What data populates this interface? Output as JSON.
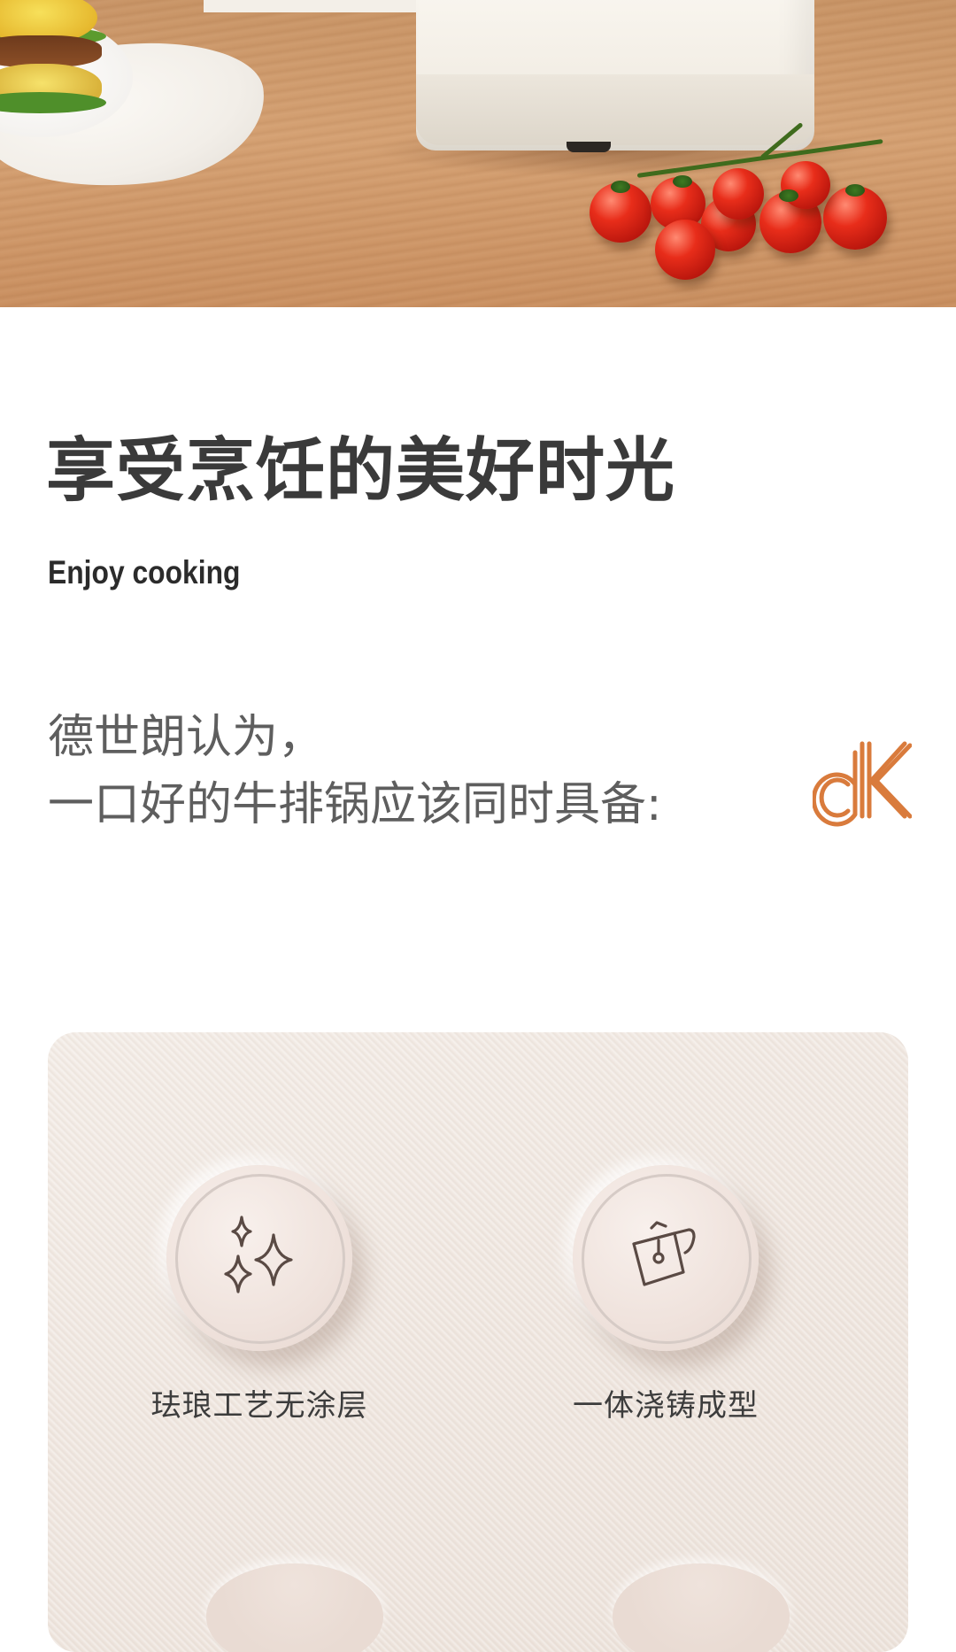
{
  "brand": {
    "accent": "#d97b3c",
    "text_dark": "#3a3a3a",
    "text_grey": "#5e5e5e"
  },
  "hero": {
    "image_subject": "kitchen counter with white appliance, burger plate and cherry tomatoes"
  },
  "headline": "享受烹饪的美好时光",
  "subheadline": "Enjoy cooking",
  "intro": {
    "line1": "德世朗认为，",
    "line2": "一口好的牛排锅应该同时具备:"
  },
  "logo_icon": "dk-logo",
  "features": [
    {
      "label": "珐琅工艺无涂层",
      "icon": "sparkles-icon"
    },
    {
      "label": "一体浇铸成型",
      "icon": "pot-pour-icon"
    }
  ]
}
